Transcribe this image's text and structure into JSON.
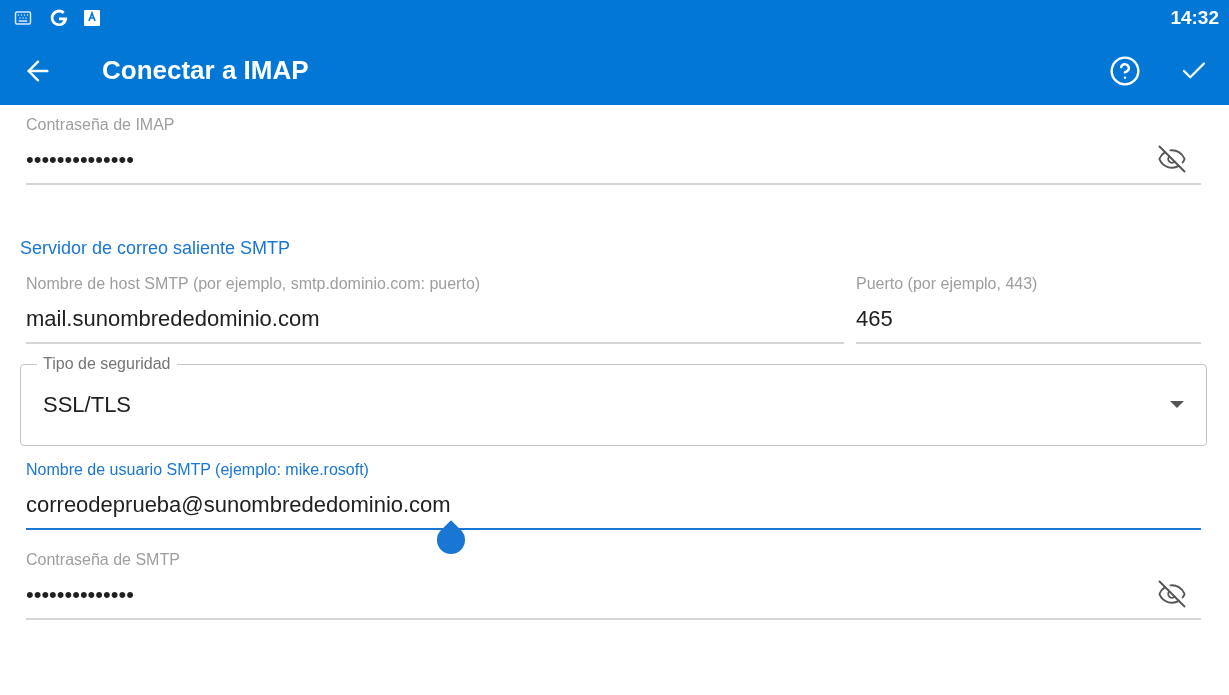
{
  "status_bar": {
    "time": "14:32"
  },
  "toolbar": {
    "title": "Conectar a IMAP"
  },
  "imap_password": {
    "label": "Contraseña de IMAP",
    "value": "••••••••••••••",
    "focused": false
  },
  "smtp_section": {
    "title": "Servidor de correo saliente SMTP"
  },
  "smtp_host": {
    "label": "Nombre de host SMTP (por ejemplo, smtp.dominio.com: puerto)",
    "value": "mail.sunombrededominio.com",
    "focused": false
  },
  "smtp_port": {
    "label": "Puerto (por ejemplo, 443)",
    "value": "465",
    "focused": false
  },
  "security_type": {
    "label": "Tipo de seguridad",
    "value": "SSL/TLS"
  },
  "smtp_username": {
    "label": "Nombre de usuario SMTP (ejemplo: mike.rosoft)",
    "value": "correodeprueba@sunombrededominio.com",
    "focused": true
  },
  "smtp_password": {
    "label": "Contraseña de SMTP",
    "value": "••••••••••••••",
    "focused": false
  }
}
